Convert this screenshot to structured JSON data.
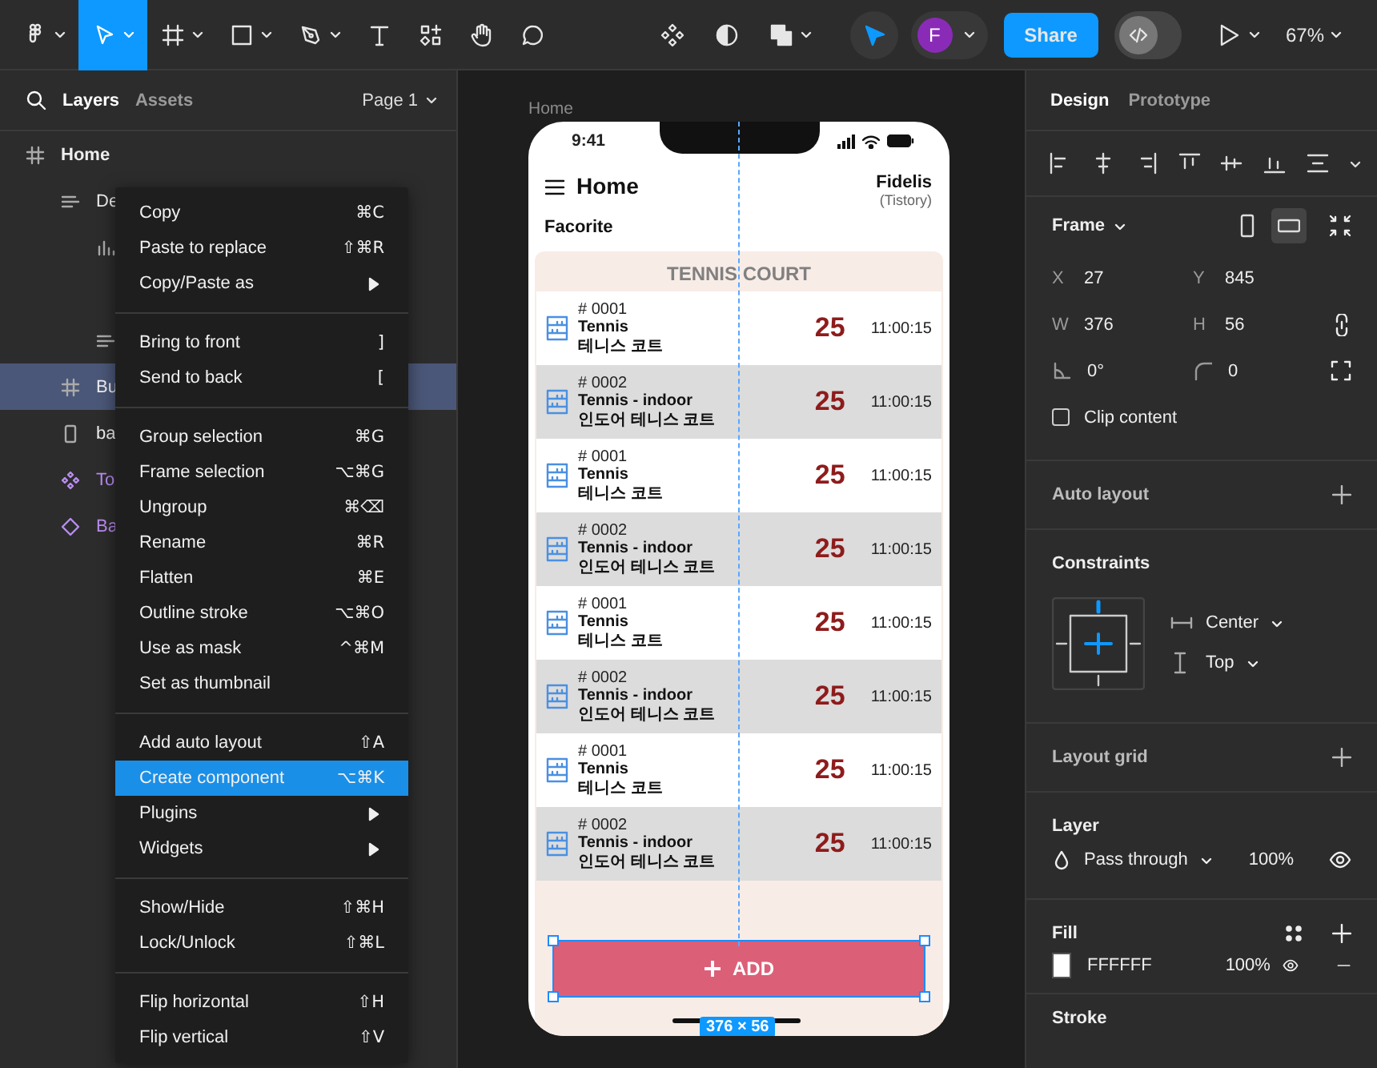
{
  "toolbar": {
    "tools": [
      {
        "kind": "logo",
        "menu": true,
        "selected": false
      },
      {
        "kind": "move",
        "menu": true,
        "selected": true
      },
      {
        "kind": "frame",
        "menu": true,
        "selected": false
      },
      {
        "kind": "shape",
        "menu": true,
        "selected": false
      },
      {
        "kind": "pen",
        "menu": true,
        "selected": false
      },
      {
        "kind": "text",
        "menu": false,
        "selected": false
      },
      {
        "kind": "resources",
        "menu": false,
        "selected": false
      },
      {
        "kind": "hand",
        "menu": false,
        "selected": false
      },
      {
        "kind": "comment",
        "menu": false,
        "selected": false
      }
    ],
    "center_tools": [
      {
        "kind": "component",
        "menu": false
      },
      {
        "kind": "mask",
        "menu": false
      },
      {
        "kind": "boolean",
        "menu": true
      }
    ],
    "avatar": "F",
    "share": "Share",
    "dev_mode": false,
    "zoom": "67%"
  },
  "layers": {
    "tabs": [
      {
        "label": "Layers",
        "selected": true
      },
      {
        "label": "Assets",
        "selected": false
      }
    ],
    "page": "Page 1",
    "items": [
      {
        "kind": "frame",
        "label": "Home",
        "selected": false,
        "children": [
          {
            "kind": "text",
            "label": "De",
            "selected": false,
            "children": [
              {
                "kind": "chart",
                "selected": false
              },
              {
                "kind": "text",
                "selected": false
              }
            ]
          },
          {
            "kind": "frame",
            "label": "Bu",
            "selected": true
          },
          {
            "kind": "rectangle",
            "label": "ba",
            "selected": false
          },
          {
            "kind": "component",
            "label": "To",
            "selected": false
          },
          {
            "kind": "instance",
            "label": "Ba",
            "selected": false
          }
        ]
      }
    ]
  },
  "context_menu": {
    "sections": [
      {
        "items": [
          {
            "label": "Copy",
            "shortcut": "⌘C",
            "submenu": false,
            "selected": false
          },
          {
            "label": "Paste to replace",
            "shortcut": "⇧⌘R",
            "submenu": false,
            "selected": false
          },
          {
            "label": "Copy/Paste as",
            "submenu": true,
            "selected": false
          }
        ]
      },
      {
        "items": [
          {
            "label": "Bring to front",
            "shortcut": "]",
            "submenu": false,
            "selected": false
          },
          {
            "label": "Send to back",
            "shortcut": "[",
            "submenu": false,
            "selected": false
          }
        ]
      },
      {
        "items": [
          {
            "label": "Group selection",
            "shortcut": "⌘G",
            "submenu": false,
            "selected": false
          },
          {
            "label": "Frame selection",
            "shortcut": "⌥⌘G",
            "submenu": false,
            "selected": false
          },
          {
            "label": "Ungroup",
            "shortcut": "⌘⌫",
            "submenu": false,
            "selected": false
          },
          {
            "label": "Rename",
            "shortcut": "⌘R",
            "submenu": false,
            "selected": false
          },
          {
            "label": "Flatten",
            "shortcut": "⌘E",
            "submenu": false,
            "selected": false
          },
          {
            "label": "Outline stroke",
            "shortcut": "⌥⌘O",
            "submenu": false,
            "selected": false
          },
          {
            "label": "Use as mask",
            "shortcut": "^⌘M",
            "submenu": false,
            "selected": false
          },
          {
            "label": "Set as thumbnail",
            "submenu": false,
            "selected": false
          }
        ]
      },
      {
        "items": [
          {
            "label": "Add auto layout",
            "shortcut": "⇧A",
            "submenu": false,
            "selected": false
          },
          {
            "label": "Create component",
            "shortcut": "⌥⌘K",
            "submenu": false,
            "selected": true
          },
          {
            "label": "Plugins",
            "submenu": true,
            "selected": false
          },
          {
            "label": "Widgets",
            "submenu": true,
            "selected": false
          }
        ]
      },
      {
        "items": [
          {
            "label": "Show/Hide",
            "shortcut": "⇧⌘H",
            "submenu": false,
            "selected": false
          },
          {
            "label": "Lock/Unlock",
            "shortcut": "⇧⌘L",
            "submenu": false,
            "selected": false
          }
        ]
      },
      {
        "items": [
          {
            "label": "Flip horizontal",
            "shortcut": "⇧H",
            "submenu": false,
            "selected": false
          },
          {
            "label": "Flip vertical",
            "shortcut": "⇧V",
            "submenu": false,
            "selected": false
          }
        ]
      }
    ]
  },
  "canvas": {
    "frame_label": "Home",
    "phone": {
      "time": "9:41",
      "title": "Home",
      "account": "Fidelis",
      "account_sub": "(Tistory)",
      "section": "Facorite",
      "list_title": "TENNIS COURT",
      "rows": [
        {
          "code": "# 0001",
          "name": "Tennis",
          "name_ko": "테니스 코트",
          "count": "25",
          "time": "11:00:15",
          "shaded": false
        },
        {
          "code": "# 0002",
          "name": "Tennis - indoor",
          "name_ko": "인도어 테니스 코트",
          "count": "25",
          "time": "11:00:15",
          "shaded": true
        },
        {
          "code": "# 0001",
          "name": "Tennis",
          "name_ko": "테니스 코트",
          "count": "25",
          "time": "11:00:15",
          "shaded": false
        },
        {
          "code": "# 0002",
          "name": "Tennis - indoor",
          "name_ko": "인도어 테니스 코트",
          "count": "25",
          "time": "11:00:15",
          "shaded": true
        },
        {
          "code": "# 0001",
          "name": "Tennis",
          "name_ko": "테니스 코트",
          "count": "25",
          "time": "11:00:15",
          "shaded": false
        },
        {
          "code": "# 0002",
          "name": "Tennis - indoor",
          "name_ko": "인도어 테니스 코트",
          "count": "25",
          "time": "11:00:15",
          "shaded": true
        },
        {
          "code": "# 0001",
          "name": "Tennis",
          "name_ko": "테니스 코트",
          "count": "25",
          "time": "11:00:15",
          "shaded": false
        },
        {
          "code": "# 0002",
          "name": "Tennis - indoor",
          "name_ko": "인도어 테니스 코트",
          "count": "25",
          "time": "11:00:15",
          "shaded": true
        }
      ],
      "button": {
        "label": "ADD",
        "selected": true
      },
      "size": "376 × 56"
    }
  },
  "design": {
    "tabs": [
      {
        "label": "Design",
        "selected": true
      },
      {
        "label": "Prototype",
        "selected": false
      }
    ],
    "frame": {
      "title": "Frame",
      "orientation": [
        {
          "kind": "portrait",
          "selected": false
        },
        {
          "kind": "landscape",
          "selected": true
        }
      ],
      "fields": [
        {
          "kind": "label",
          "label": "X",
          "value": "27"
        },
        {
          "kind": "label",
          "label": "Y",
          "value": "845"
        },
        {
          "kind": "label",
          "label": "W",
          "value": "376"
        },
        {
          "kind": "label",
          "label": "H",
          "value": "56"
        },
        {
          "kind": "rotation",
          "value": "0°"
        },
        {
          "kind": "radius",
          "value": "0"
        }
      ],
      "clip": {
        "label": "Clip content",
        "checked": false
      }
    },
    "auto_layout": {
      "title": "Auto layout"
    },
    "constraints": {
      "title": "Constraints",
      "horizontal": "Center",
      "vertical": "Top"
    },
    "layout_grid": {
      "title": "Layout grid"
    },
    "layer": {
      "title": "Layer",
      "blend": "Pass through",
      "opacity": "100%"
    },
    "fill": {
      "title": "Fill",
      "hex": "FFFFFF",
      "opacity": "100%"
    },
    "stroke": {
      "title": "Stroke"
    }
  }
}
